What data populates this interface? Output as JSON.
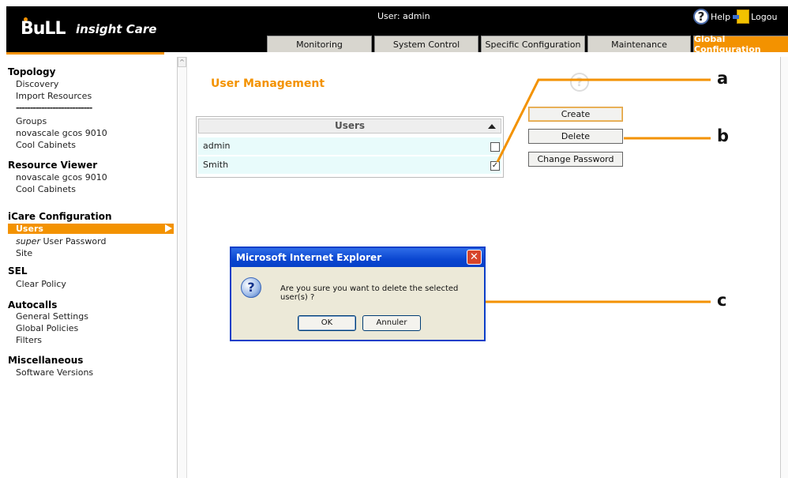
{
  "header": {
    "logo_text": "BuLL",
    "app_title": "insight Care",
    "user_label": "User: admin",
    "help_label": "Help",
    "logout_label": "Logou",
    "tabs": [
      {
        "label": "Monitoring",
        "active": false
      },
      {
        "label": "System Control",
        "active": false
      },
      {
        "label": "Specific Configuration",
        "active": false
      },
      {
        "label": "Maintenance",
        "active": false
      },
      {
        "label": "Global Configuration",
        "active": true
      }
    ]
  },
  "sidebar": {
    "topology": {
      "title": "Topology",
      "items": [
        "Discovery",
        "Import Resources"
      ],
      "separator": "---------------------------",
      "items2": [
        "Groups",
        "novascale gcos 9010",
        "Cool Cabinets"
      ]
    },
    "resource_viewer": {
      "title": "Resource Viewer",
      "items": [
        "novascale gcos 9010",
        "Cool Cabinets"
      ]
    },
    "icare_config": {
      "title": "iCare Configuration",
      "selected": "Users",
      "super_prefix": "super",
      "super_rest": " User Password",
      "site": "Site"
    },
    "sel": {
      "title": "SEL",
      "items": [
        "Clear Policy"
      ]
    },
    "autocalls": {
      "title": "Autocalls",
      "items": [
        "General Settings",
        "Global Policies",
        "Filters"
      ]
    },
    "misc": {
      "title": "Miscellaneous",
      "items": [
        "Software Versions"
      ]
    }
  },
  "main": {
    "heading": "User Management",
    "users_table": {
      "header": "Users",
      "rows": [
        {
          "name": "admin",
          "checked": false
        },
        {
          "name": "Smith",
          "checked": true
        }
      ]
    },
    "buttons": {
      "create": "Create",
      "delete": "Delete",
      "change_password": "Change Password"
    }
  },
  "dialog": {
    "title": "Microsoft Internet Explorer",
    "message": "Are you sure you want to delete the selected user(s) ?",
    "ok": "OK",
    "cancel": "Annuler"
  },
  "callouts": {
    "a": "a",
    "b": "b",
    "c": "c"
  },
  "colors": {
    "accent": "#f39200",
    "header_bg": "#000000",
    "row_bg": "#e8fbfb",
    "dialog_titlebar": "#0a46d0"
  }
}
